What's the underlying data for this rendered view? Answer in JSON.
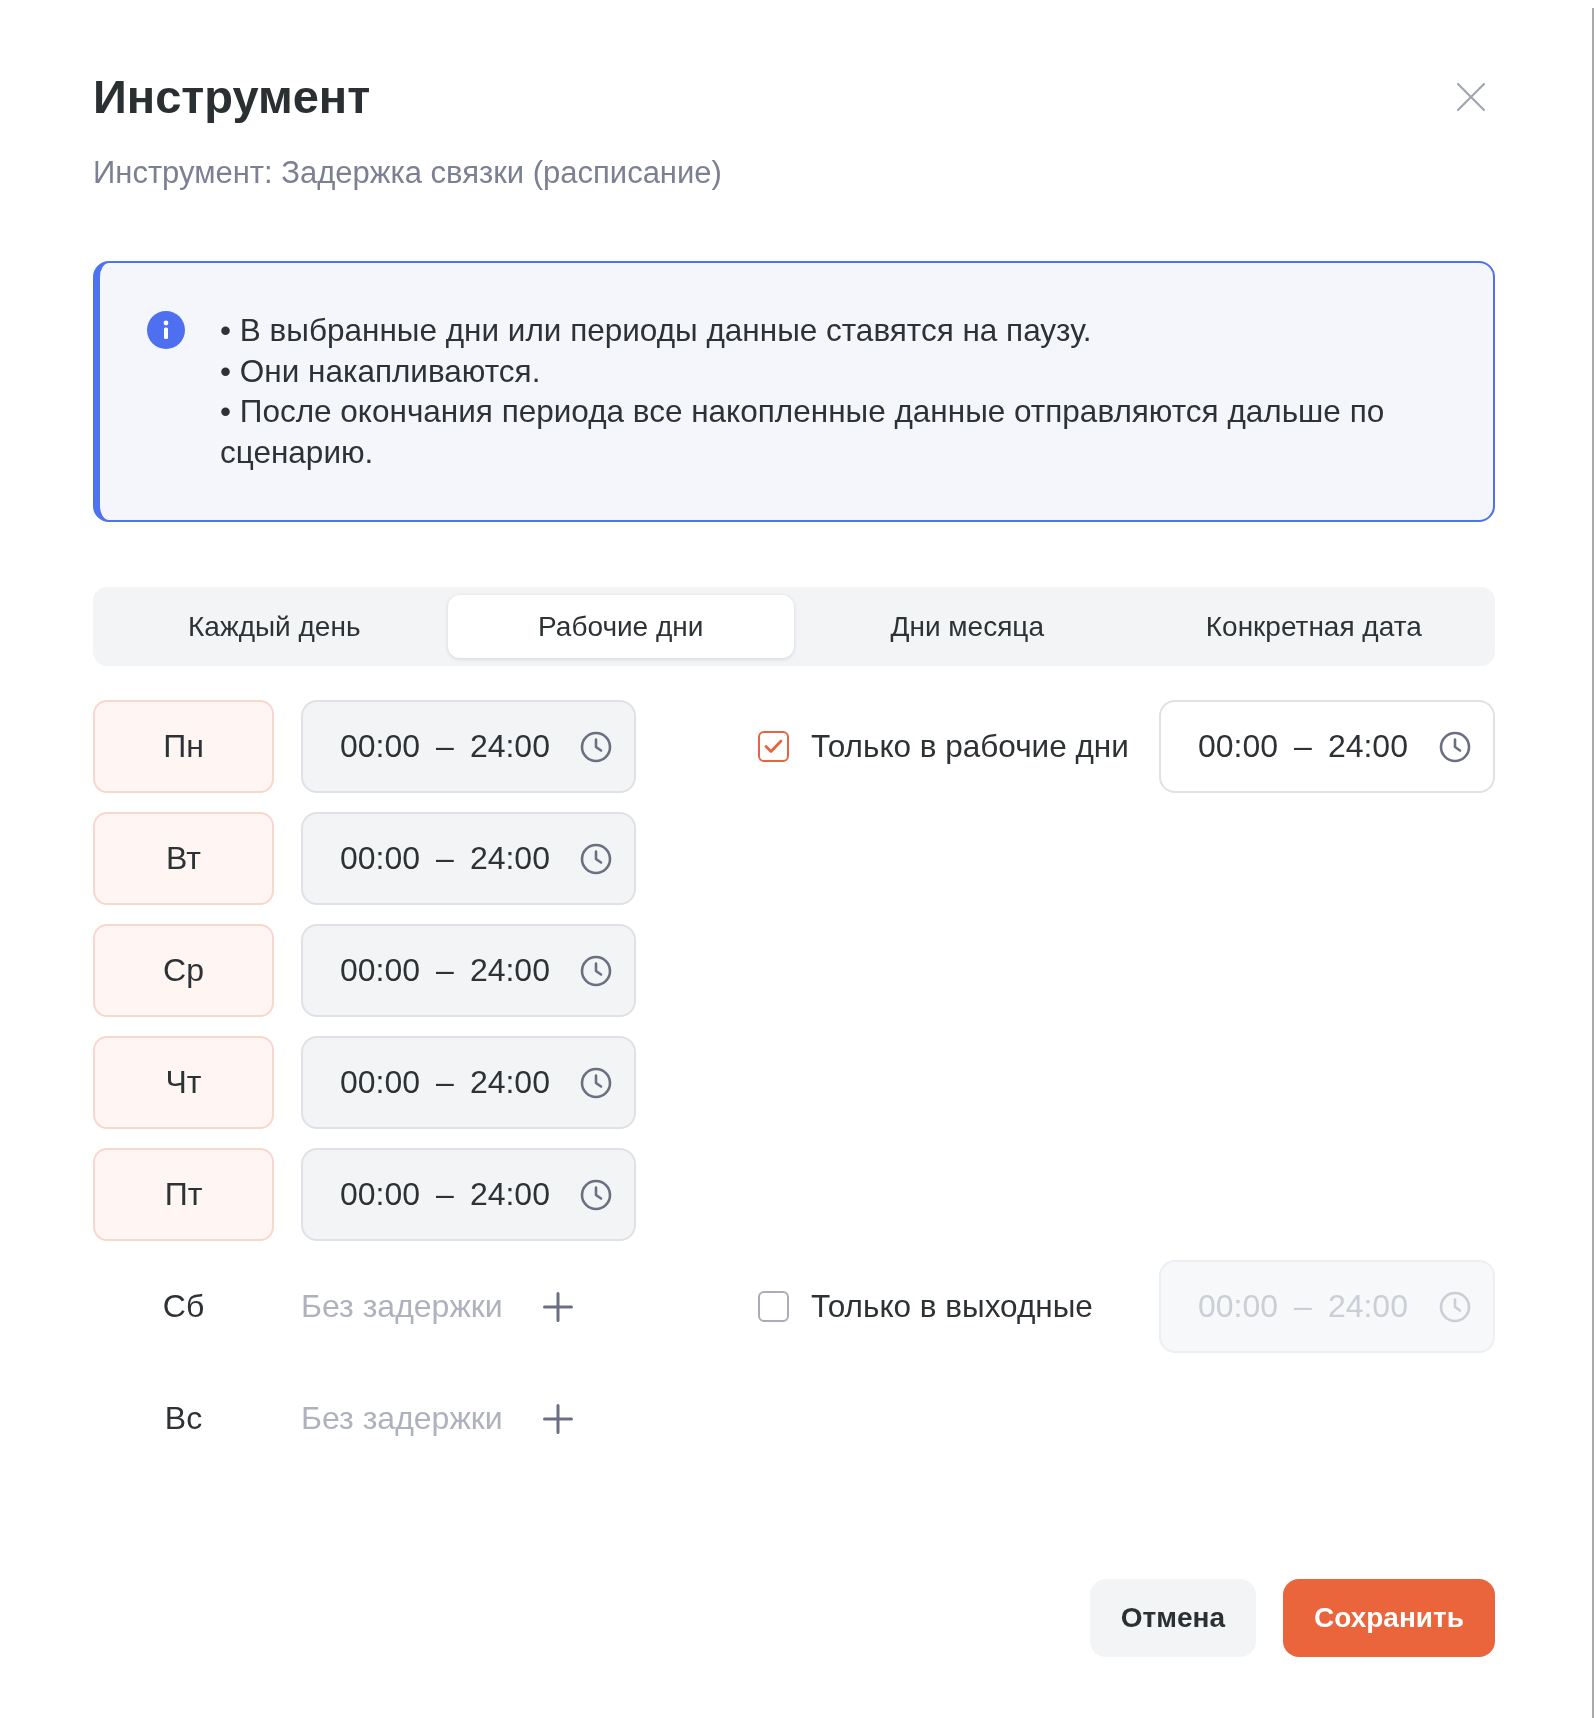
{
  "dialog": {
    "title": "Инструмент",
    "subtitle": "Инструмент: Задержка связки (расписание)"
  },
  "info": {
    "lines": [
      "• В выбранные дни или периоды данные ставятся на паузу.",
      "• Они накапливаются.",
      "• После окончания периода все накопленные данные отправляются дальше по сценарию."
    ]
  },
  "tabs": [
    {
      "label": "Каждый день",
      "selected": false
    },
    {
      "label": "Рабочие дни",
      "selected": true
    },
    {
      "label": "Дни месяца",
      "selected": false
    },
    {
      "label": "Конкретная дата",
      "selected": false
    }
  ],
  "groups": [
    {
      "days": [
        {
          "label": "Пн",
          "delay": true,
          "range": {
            "from": "00:00",
            "separator": "–",
            "to": "24:00"
          }
        },
        {
          "label": "Вт",
          "delay": true,
          "range": {
            "from": "00:00",
            "separator": "–",
            "to": "24:00"
          }
        },
        {
          "label": "Ср",
          "delay": true,
          "range": {
            "from": "00:00",
            "separator": "–",
            "to": "24:00"
          }
        },
        {
          "label": "Чт",
          "delay": true,
          "range": {
            "from": "00:00",
            "separator": "–",
            "to": "24:00"
          }
        },
        {
          "label": "Пт",
          "delay": true,
          "range": {
            "from": "00:00",
            "separator": "–",
            "to": "24:00"
          }
        }
      ],
      "option": {
        "label": "Только в рабочие дни",
        "checked": true,
        "range": {
          "from": "00:00",
          "separator": "–",
          "to": "24:00"
        }
      }
    },
    {
      "days": [
        {
          "label": "Сб",
          "delay": false,
          "note": "Без задержки"
        },
        {
          "label": "Вс",
          "delay": false,
          "note": "Без задержки"
        }
      ],
      "option": {
        "label": "Только в выходные",
        "checked": false,
        "range": {
          "from": "00:00",
          "separator": "–",
          "to": "24:00"
        }
      }
    }
  ],
  "buttons": [
    {
      "label": "Отмена",
      "kind": "secondary"
    },
    {
      "label": "Сохранить",
      "kind": "primary"
    }
  ]
}
